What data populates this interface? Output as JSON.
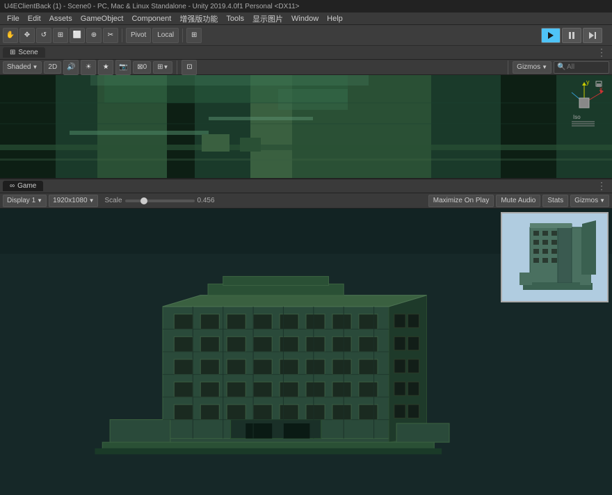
{
  "titleBar": {
    "text": "U4EClientBack (1) - Scene0 - PC, Mac & Linux Standalone - Unity 2019.4.0f1 Personal <DX11>"
  },
  "menuBar": {
    "items": [
      "File",
      "Edit",
      "Assets",
      "GameObject",
      "Component",
      "增强版功能",
      "Tools",
      "显示图片",
      "Window",
      "Help"
    ]
  },
  "toolbar": {
    "tools": [
      "✋",
      "↔",
      "↺",
      "⊞",
      "⬜",
      "⊕",
      "✂"
    ],
    "pivotLabel": "Pivot",
    "localLabel": "Local",
    "extraIcon": "⊞"
  },
  "playControls": {
    "play": "▶",
    "pause": "⏸",
    "step": "⏭"
  },
  "scenePanel": {
    "tabLabel": "Scene",
    "tabIcon": "⊞",
    "shadedLabel": "Shaded",
    "twoDLabel": "2D",
    "icons": [
      "🔊",
      "⊡",
      "🔆",
      "⊠"
    ],
    "zeroLabel": "0",
    "moreLabel": "⊞",
    "gizmosLabel": "Gizmos",
    "searchPlaceholder": "All",
    "searchIcon": "🔍"
  },
  "gamePanel": {
    "tabLabel": "Game",
    "tabIcon": "⊞",
    "display1Label": "Display 1",
    "resolutionLabel": "1920x1080",
    "scaleLabel": "Scale",
    "scaleValue": "0.456",
    "maximizeLabel": "Maximize On Play",
    "muteLabel": "Mute Audio",
    "statsLabel": "Stats",
    "gizmosLabel": "Gizmos"
  },
  "colors": {
    "sceneBgDark": "#1a3a2a",
    "sceneBgMid": "#2a5040",
    "sceneBgLight": "#3a6050",
    "buildingGreen": "#2d5a40",
    "buildingDark": "#1a2a20",
    "buildingLight": "#4a8060",
    "gameBg": "#1a2a2a",
    "thumbBg": "#b0cce0",
    "thumbBuilding": "#4a7060"
  }
}
